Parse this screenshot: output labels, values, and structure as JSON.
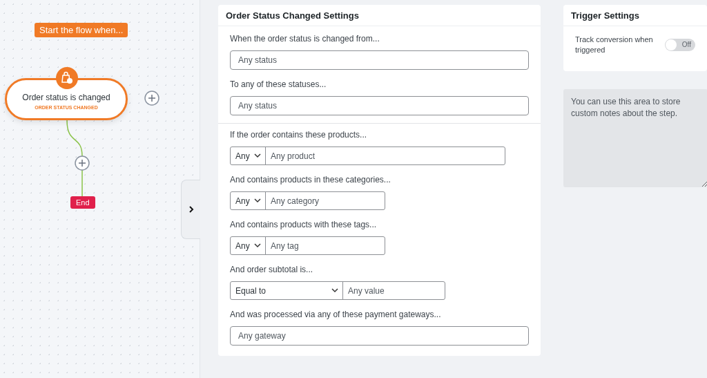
{
  "canvas": {
    "start_label": "Start the flow when...",
    "trigger_node": {
      "title": "Order status is changed",
      "subtitle": "ORDER STATUS CHANGED"
    },
    "end_label": "End"
  },
  "settings": {
    "title": "Order Status Changed Settings",
    "sections": [
      {
        "fields": [
          {
            "kind": "text",
            "label": "When the order status is changed from...",
            "placeholder": "Any status"
          },
          {
            "kind": "text",
            "label": "To any of these statuses...",
            "placeholder": "Any status"
          }
        ]
      },
      {
        "fields": [
          {
            "kind": "match",
            "label": "If the order contains these products...",
            "match": "Any",
            "placeholder": "Any product"
          },
          {
            "kind": "match",
            "label": "And contains products in these categories...",
            "match": "Any",
            "placeholder": "Any category"
          },
          {
            "kind": "match",
            "label": "And contains products with these tags...",
            "match": "Any",
            "placeholder": "Any tag"
          },
          {
            "kind": "compare",
            "label": "And order subtotal is...",
            "operator": "Equal to",
            "placeholder": "Any value"
          },
          {
            "kind": "text",
            "label": "And was processed via any of these payment gateways...",
            "placeholder": "Any gateway"
          }
        ]
      }
    ]
  },
  "trigger_settings": {
    "title": "Trigger Settings",
    "track_label": "Track conversion when triggered",
    "track_on": false,
    "toggle_text": "Off"
  },
  "notes": {
    "placeholder": "You can use this area to store custom notes about the step."
  }
}
